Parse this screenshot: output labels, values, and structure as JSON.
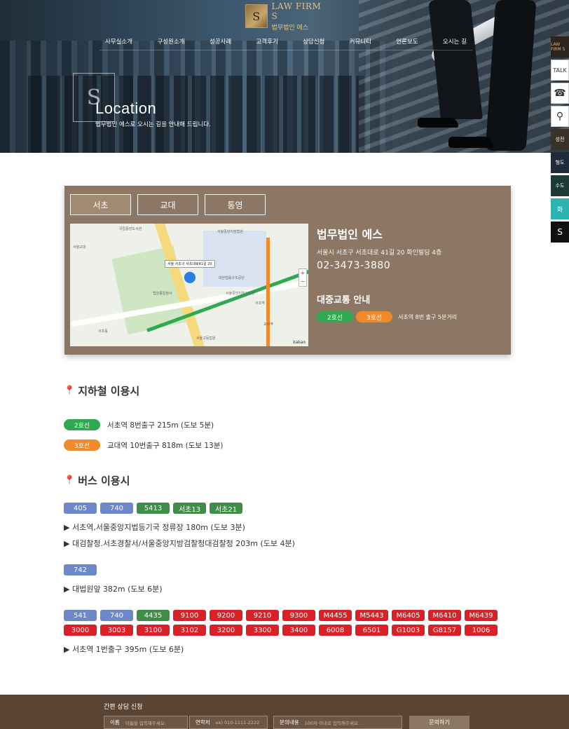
{
  "logo": {
    "mark": "S",
    "en": "LAW FIRM S",
    "ko": "법무법인 에스"
  },
  "nav": [
    "사무실소개",
    "구성원소개",
    "성공사례",
    "고객후기",
    "상담신청",
    "커뮤니티",
    "언론보도",
    "오시는 길"
  ],
  "hero": {
    "title": "Location",
    "subtitle": "법무법인 에스로 오시는 길을 안내해 드립니다."
  },
  "quick": {
    "talk": "TALK",
    "dark1": "성전",
    "dark2": "형도",
    "dark3": "수도",
    "teal": "화",
    "seal": "S"
  },
  "tabs": [
    "서초",
    "교대",
    "통영"
  ],
  "map": {
    "label": "서울 서초구 서초대로41길 20",
    "kakao": "kakao",
    "texts": [
      "국립중앙도서관",
      "서울중앙지방법원",
      "서울교대",
      "대한법률구조공단",
      "서울중앙지방검찰청",
      "서초역",
      "법원종합청사",
      "서초동",
      "교대역",
      "서울고등법원"
    ]
  },
  "info": {
    "name": "법무법인 에스",
    "address": "서울시 서초구 서초대로 41길 20 화인빌딩 4층",
    "tel": "02-3473-3880",
    "transit_title": "대중교통 안내",
    "line2": "2호선",
    "line3": "3호선",
    "transit_note": "서초역 8번 출구 5분거리"
  },
  "subway": {
    "title": "지하철 이용시",
    "rows": [
      {
        "line": "2호선",
        "text": "서초역 8번출구 215m (도보 5분)"
      },
      {
        "line": "3호선",
        "text": "교대역 10번출구 818m (도보 13분)"
      }
    ]
  },
  "bus": {
    "title": "버스 이용시",
    "group1": [
      "405",
      "740",
      "5413",
      "서초13",
      "서초21"
    ],
    "group1_text1": "▶ 서초역,서울중앙지법등기국 정류장 180m (도보 3분)",
    "group1_text2": "▶ 대검찰청.서초경찰서/서울중앙지방검찰청대검찰청 203m (도보 4분)",
    "group2": [
      "742"
    ],
    "group2_text": "▶ 대법원앞 382m (도보 6분)",
    "group3_row1": [
      "541",
      "740",
      "4435",
      "9100",
      "9200",
      "9210",
      "9300",
      "M4455",
      "M5443",
      "M6405",
      "M6410",
      "M6439"
    ],
    "group3_row2": [
      "3000",
      "3003",
      "3100",
      "3102",
      "3200",
      "3300",
      "3400",
      "6008",
      "6501",
      "G1003",
      "G8157",
      "1006"
    ],
    "group3_text": "▶ 서초역 1번출구 395m (도보 6분)"
  },
  "footer": {
    "title": "간편 상담 신청",
    "name_label": "이름",
    "name_ph": "이름을 입력해주세요.",
    "phone_label": "연락처",
    "phone_ph": "ex) 010-1111-2222",
    "content_label": "문의내용",
    "content_ph": "100자 이내로 입력해주세요.",
    "submit": "문의하기"
  },
  "colors": {
    "line2": "#2fa84f",
    "line3": "#f08a2a",
    "bus_blue": "#6e87c9",
    "bus_green": "#3e8e47",
    "bus_red": "#d92228",
    "card": "#8b7763",
    "footer": "#5a4535"
  }
}
